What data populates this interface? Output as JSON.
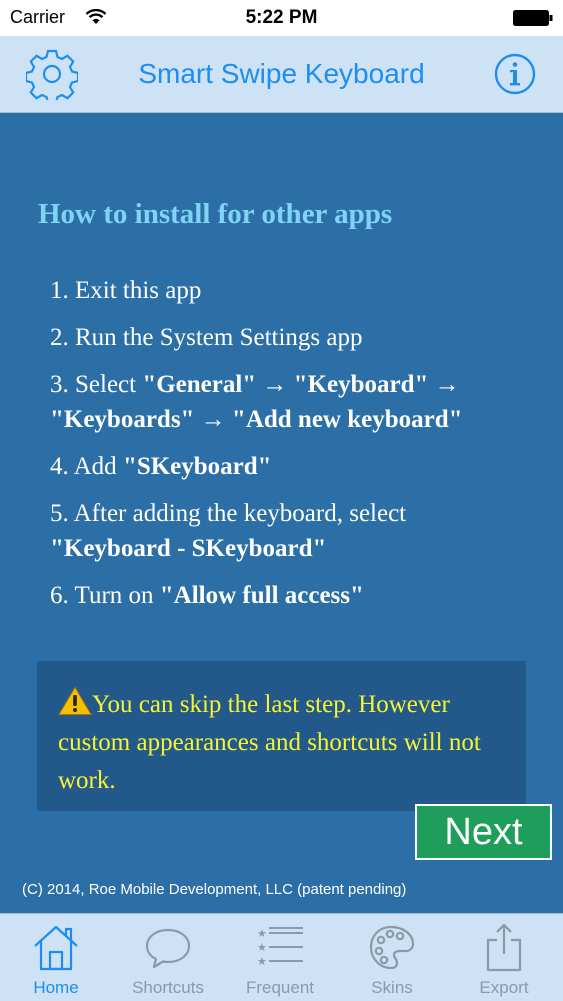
{
  "status_bar": {
    "carrier": "Carrier",
    "time": "5:22 PM"
  },
  "nav_bar": {
    "title": "Smart Swipe Keyboard"
  },
  "content": {
    "heading": "How to install for other apps",
    "steps": {
      "s1": "1. Exit this app",
      "s2": "2. Run the System Settings app",
      "s3_prefix": "3. Select ",
      "s3_bold": "\"General\" → \"Keyboard\" → \"Keyboards\" → \"Add new keyboard\"",
      "s4_prefix": "4. Add ",
      "s4_bold": "\"SKeyboard\"",
      "s5_prefix": "5. After adding the keyboard, select ",
      "s5_bold": "\"Keyboard - SKeyboard\"",
      "s6_prefix": "6. Turn on ",
      "s6_bold": "\"Allow full access\""
    },
    "warning": "You can skip the last step. However custom appearances and shortcuts will not work.",
    "next_label": "Next",
    "copyright": "(C) 2014, Roe Mobile Development, LLC (patent pending)"
  },
  "tab_bar": {
    "tabs": [
      {
        "label": "Home",
        "icon": "home-icon",
        "active": true
      },
      {
        "label": "Shortcuts",
        "icon": "speech-bubble-icon",
        "active": false
      },
      {
        "label": "Frequent",
        "icon": "starred-list-icon",
        "active": false
      },
      {
        "label": "Skins",
        "icon": "palette-icon",
        "active": false
      },
      {
        "label": "Export",
        "icon": "share-icon",
        "active": false
      }
    ]
  },
  "colors": {
    "background": "#2b6fa6",
    "bar_background": "#cde2f4",
    "accent": "#1d8ef0",
    "heading": "#7fd4f5",
    "warning_text": "#f5f532",
    "next_button": "#1f9d5a"
  }
}
